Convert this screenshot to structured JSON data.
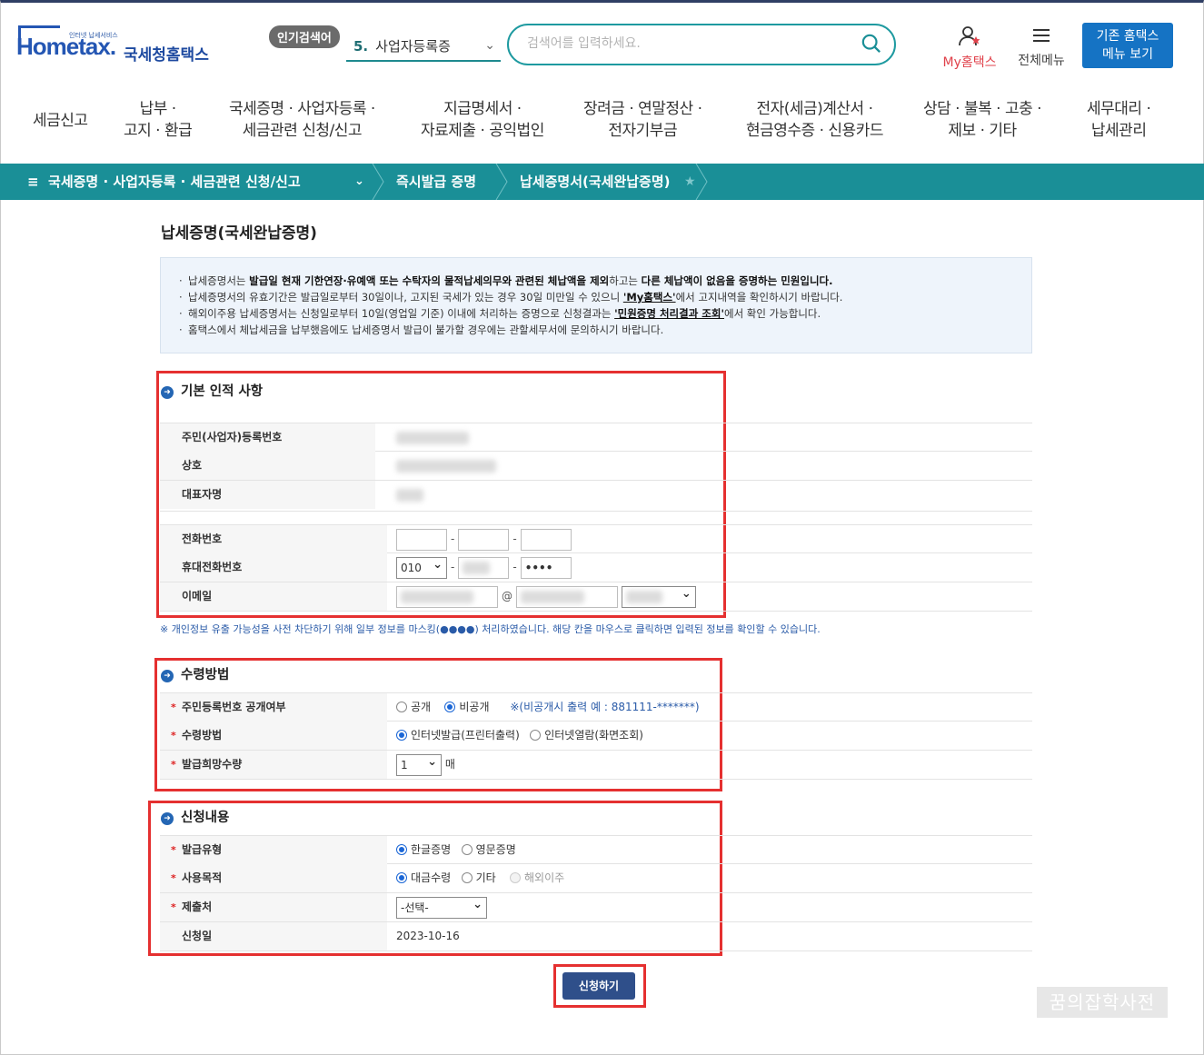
{
  "header": {
    "logo_small": "인터넷 납세서비스",
    "logo_main": "Hometax.",
    "logo_kr": "국세청홈택스",
    "popular_badge": "인기검색어",
    "popular_num": "5.",
    "popular_term": "사업자등록증",
    "search_placeholder": "검색어를 입력하세요.",
    "my_hometax": "My홈택스",
    "all_menu": "전체메뉴",
    "old_menu_line1": "기존 홈택스",
    "old_menu_line2": "메뉴 보기"
  },
  "gnb": [
    "세금신고",
    "납부 ·\n고지 · 환급",
    "국세증명 · 사업자등록 ·\n세금관련 신청/신고",
    "지급명세서 ·\n자료제출 · 공익법인",
    "장려금 · 연말정산 ·\n전자기부금",
    "전자(세금)계산서 ·\n현금영수증 · 신용카드",
    "상담 · 불복 · 고충 ·\n제보 · 기타",
    "세무대리 ·\n납세관리"
  ],
  "breadcrumb": {
    "menu": "국세증명 · 사업자등록 · 세금관련 신청/신고",
    "level2": "즉시발급 증명",
    "level3": "납세증명서(국세완납증명)"
  },
  "page_title": "납세증명(국세완납증명)",
  "notice": {
    "l1_a": "납세증명서는 ",
    "l1_b": "발급일 현재 기한연장·유예액 또는 수탁자의 물적납세의무와 관련된 체납액을 제외",
    "l1_c": "하고는 ",
    "l1_d": "다른 체납액이 없음을 증명하는 민원입니다.",
    "l2_a": "납세증명서의 유효기간은 발급일로부터 30일이나, 고지된 국세가 있는 경우 30일 미만일 수 있으니 ",
    "l2_link": "'My홈택스'",
    "l2_b": "에서 고지내역을 확인하시기 바랍니다.",
    "l3_a": "해외이주용 납세증명서는 신청일로부터 10일(영업일 기준) 이내에 처리하는 증명으로 신청결과는 ",
    "l3_link": "'민원증명 처리결과 조회'",
    "l3_b": "에서 확인 가능합니다.",
    "l4": "홈택스에서 체납세금을 납부했음에도 납세증명서 발급이 불가할 경우에는 관할세무서에 문의하시기 바랍니다."
  },
  "basic": {
    "title": "기본 인적 사항",
    "rrn_label": "주민(사업자)등록번호",
    "name_label": "상호",
    "rep_label": "대표자명",
    "phone_label": "전화번호",
    "mobile_label": "휴대전화번호",
    "mobile_prefix": "010",
    "mobile_last": "••••",
    "email_label": "이메일",
    "at": "@"
  },
  "mask_note": "※ 개인정보 유출 가능성을 사전 차단하기 위해 일부 정보를 마스킹(●●●●) 처리하였습니다. 해당 칸을 마우스로 클릭하면 입력된 정보를 확인할 수 있습니다.",
  "receive": {
    "title": "수령방법",
    "disclose_label": "주민등록번호 공개여부",
    "opt_public": "공개",
    "opt_private": "비공개",
    "private_note": "※(비공개시 출력 예 : 881111-*******)",
    "method_label": "수령방법",
    "opt_print": "인터넷발급(프린터출력)",
    "opt_view": "인터넷열람(화면조회)",
    "qty_label": "발급희망수량",
    "qty": "1",
    "qty_unit": "매"
  },
  "apply": {
    "title": "신청내용",
    "type_label": "발급유형",
    "opt_korean": "한글증명",
    "opt_english": "영문증명",
    "purpose_label": "사용목적",
    "opt_payment": "대금수령",
    "opt_etc": "기타",
    "opt_emigrate": "해외이주",
    "submit_to_label": "제출처",
    "submit_to_value": "-선택-",
    "date_label": "신청일",
    "date_value": "2023-10-16"
  },
  "submit_button": "신청하기",
  "watermark": "꿈의잡학사전",
  "colors": {
    "teal": "#1a8f97",
    "blue_button": "#1573c4",
    "highlight_red": "#e53030"
  }
}
